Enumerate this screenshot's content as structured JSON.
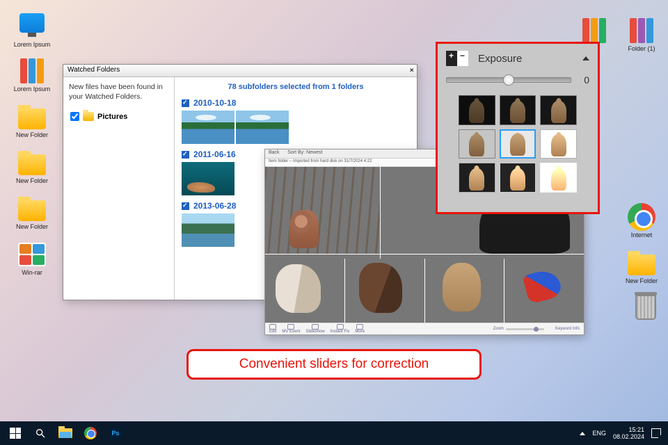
{
  "desktop": {
    "left_icons": [
      {
        "type": "pc",
        "label": "Lorem Ipsum"
      },
      {
        "type": "binders",
        "label": "Lorem Ipsum"
      },
      {
        "type": "folder",
        "label": "New Folder"
      },
      {
        "type": "folder",
        "label": "New Folder"
      },
      {
        "type": "folder",
        "label": "New Folder"
      },
      {
        "type": "winrar",
        "label": "Win-rar"
      }
    ],
    "right_icons": [
      {
        "type": "binders",
        "label": ""
      },
      {
        "type": "binders",
        "label": "Folder (1)"
      },
      {
        "type": "chrome",
        "label": "Internet"
      },
      {
        "type": "folder",
        "label": "New Folder"
      },
      {
        "type": "trash",
        "label": ""
      }
    ]
  },
  "watched_window": {
    "title": "Watched Folders",
    "message": "New files have been found in your Watched Folders.",
    "tree_item": "Pictures",
    "header": "78 subfolders selected from 1 folders",
    "groups": [
      {
        "date": "2010-10-18",
        "style": "lake",
        "count": 2
      },
      {
        "date": "2011-06-16",
        "style": "reef",
        "count": 1
      },
      {
        "date": "2013-06-28",
        "style": "river",
        "count": 1
      }
    ]
  },
  "viewer": {
    "back": "Back",
    "sortby": "Sort By:",
    "sortval": "Newest",
    "subtitle": "Item folder – Imported from hard disk on 31/7/2024 4:22",
    "bottom": {
      "b1": "Edit",
      "b2": "MV Event",
      "b3": "Slideshow",
      "b4": "Instant Fix",
      "b5": "More",
      "zoom": "Zoom",
      "keywords": "Keyword Info"
    }
  },
  "exposure": {
    "title": "Exposure",
    "value": "0"
  },
  "caption": "Convenient sliders for correction",
  "taskbar": {
    "lang": "ENG",
    "time": "15:21",
    "date": "08.02.2024"
  }
}
